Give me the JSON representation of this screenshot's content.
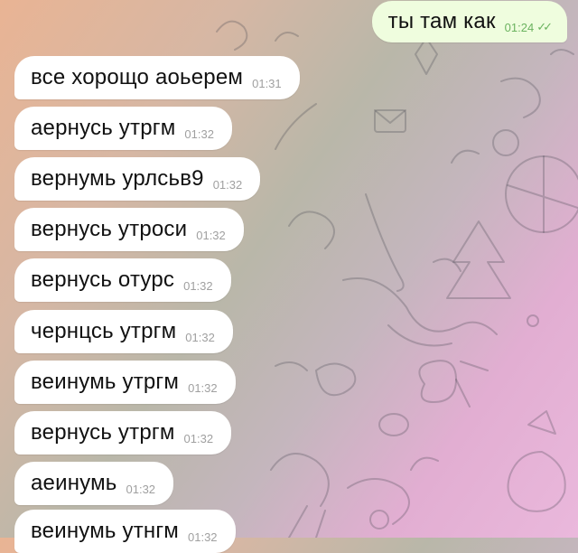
{
  "messages": [
    {
      "dir": "out",
      "text": "ты там как",
      "time": "01:24",
      "status": "read"
    },
    {
      "dir": "in",
      "text": "все хорощо аоьерем",
      "time": "01:31"
    },
    {
      "dir": "in",
      "text": "аернусь утргм",
      "time": "01:32"
    },
    {
      "dir": "in",
      "text": "вернумь урлсьв9",
      "time": "01:32"
    },
    {
      "dir": "in",
      "text": "вернусь утроси",
      "time": "01:32"
    },
    {
      "dir": "in",
      "text": "вернусь отурс",
      "time": "01:32"
    },
    {
      "dir": "in",
      "text": "чернцсь утргм",
      "time": "01:32"
    },
    {
      "dir": "in",
      "text": "веинумь утргм",
      "time": "01:32"
    },
    {
      "dir": "in",
      "text": "вернусь утргм",
      "time": "01:32"
    },
    {
      "dir": "in",
      "text": "аеинумь",
      "time": "01:32"
    },
    {
      "dir": "in",
      "text": "веинумь утнгм",
      "time": "01:32"
    }
  ],
  "colors": {
    "bubble_in": "#ffffff",
    "bubble_out": "#effdde",
    "time_out": "#6bb35f",
    "time_in": "#a0a0a0"
  },
  "icons": {
    "read_receipt": "double-check-icon"
  }
}
